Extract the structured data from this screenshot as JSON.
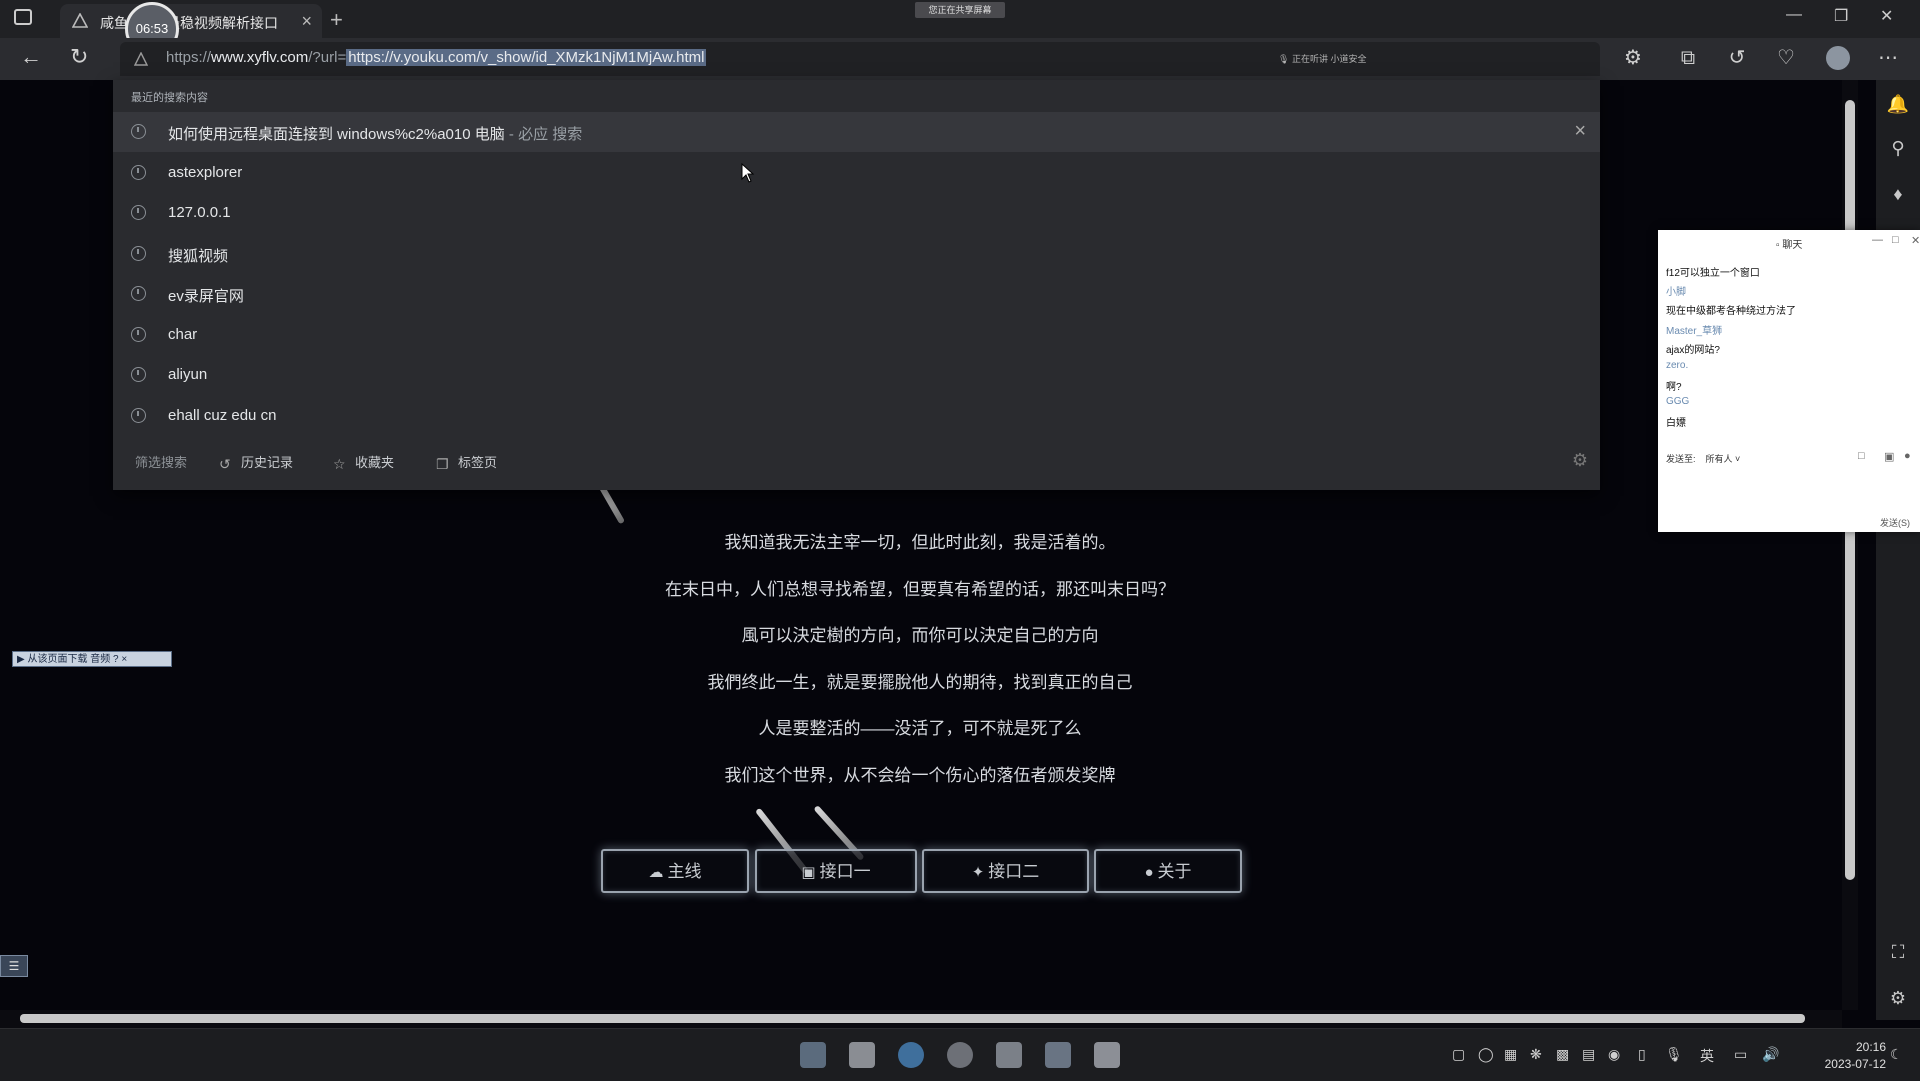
{
  "browser": {
    "tab_title": "咸鱼",
    "tab_title_tail": "最稳视频解析接口",
    "tab_close": "×",
    "new_tab": "+",
    "recording_timer": "06:53",
    "share_banner": "您正在共享屏幕",
    "url_scheme": "https://",
    "url_host": "www.xyflv.com",
    "url_path": "/?url=",
    "url_selected": "https://v.youku.com/v_show/id_XMzk1NjM1MjAw.html",
    "mic_status": "正在听讲  小道安全"
  },
  "dropdown": {
    "header": "最近的搜索内容",
    "items": [
      {
        "text": "如何使用远程桌面连接到 windows%c2%a010 电脑",
        "sub": " - 必应 搜索",
        "selected": true
      },
      {
        "text": "astexplorer",
        "sub": ""
      },
      {
        "text": "127.0.0.1",
        "sub": ""
      },
      {
        "text": "搜狐视频",
        "sub": ""
      },
      {
        "text": "ev录屏官网",
        "sub": ""
      },
      {
        "text": "char",
        "sub": ""
      },
      {
        "text": "aliyun",
        "sub": ""
      },
      {
        "text": "ehall cuz edu cn",
        "sub": ""
      }
    ],
    "remove": "×",
    "filters": {
      "label": "筛选搜索",
      "history": "历史记录",
      "favorites": "收藏夹",
      "tabs": "标签页"
    }
  },
  "page": {
    "quotes": [
      "我知道我无法主宰一切，但此时此刻，我是活着的。",
      "在末日中，人们总想寻找希望，但要真有希望的话，那还叫末日吗？",
      "風可以決定樹的方向，而你可以決定自己的方向",
      "我們终此一生，就是要擺脫他人的期待，找到真正的自己",
      "人是要整活的——没活了，可不就是死了么",
      "我们这个世界，从不会给一个伤心的落伍者颁发奖牌"
    ],
    "buttons": [
      "主线",
      "接口一",
      "接口二",
      "关于"
    ],
    "download_tip": "▶ 从该页面下载 音频",
    "download_tip_close": "? ×"
  },
  "chat": {
    "title": "聊天",
    "messages": [
      {
        "type": "text",
        "content": "f12可以独立一个窗口"
      },
      {
        "type": "user",
        "content": "小脚"
      },
      {
        "type": "text",
        "content": "现在中级都考各种绕过方法了"
      },
      {
        "type": "user",
        "content": "Master_草狮"
      },
      {
        "type": "text",
        "content": "ajax的网站?"
      },
      {
        "type": "user",
        "content": "zero."
      },
      {
        "type": "text",
        "content": "啊?"
      },
      {
        "type": "user",
        "content": "GGG"
      },
      {
        "type": "text",
        "content": "白嫖"
      }
    ],
    "send_to_label": "发送至:",
    "send_to_value": "所有人 ˅",
    "send_button": "发送(S)"
  },
  "taskbar": {
    "ime": "英",
    "time": "20:16",
    "date": "2023-07-12"
  },
  "colors": {
    "page_bg": "#05050b",
    "dropdown_bg": "#2a2b2f",
    "selection": "#5a6b86"
  }
}
